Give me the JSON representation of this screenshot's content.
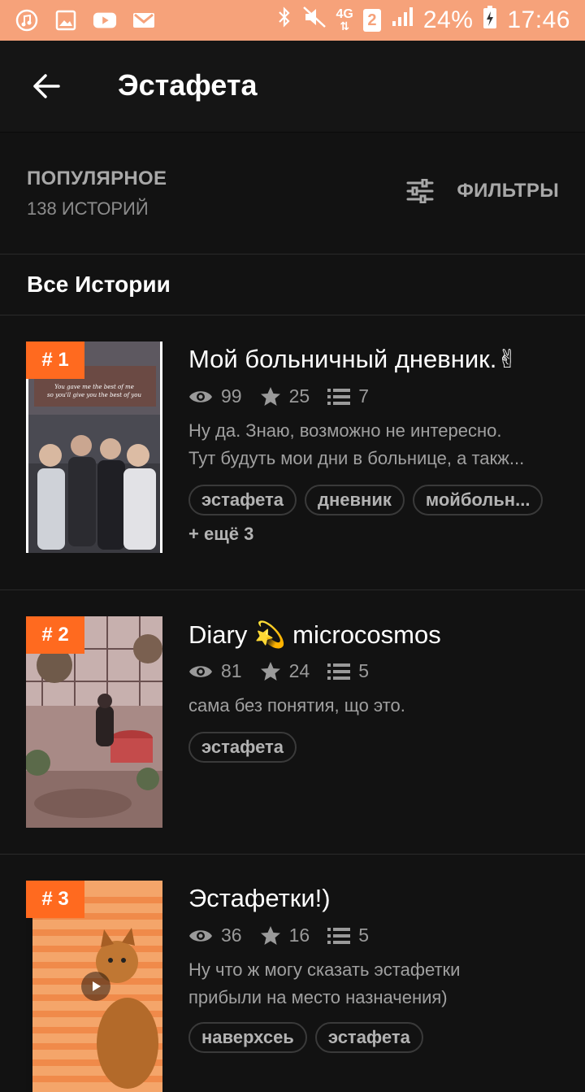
{
  "status_bar": {
    "battery": "24%",
    "time": "17:46",
    "network": "4G",
    "sim": "2",
    "bg_color": "#f6a27a"
  },
  "app_bar": {
    "title": "Эстафета"
  },
  "sort": {
    "label": "ПОПУЛЯРНОЕ",
    "count": "138 ИСТОРИЙ",
    "filter_label": "ФИЛЬТРЫ"
  },
  "section": {
    "title": "Все Истории"
  },
  "accent_color": "#ff6a1f",
  "stories": [
    {
      "rank": "# 1",
      "title": "Мой больничный дневник.✌",
      "views": "99",
      "votes": "25",
      "parts": "7",
      "desc_lines": [
        "Ну да. Знаю, возможно не интересно.",
        "Тут будуть мои дни в больнице, а такж..."
      ],
      "tags": [
        "эстафета",
        "дневник",
        "мойбольн..."
      ],
      "more": "+ ещё 3"
    },
    {
      "rank": "# 2",
      "title": "Diary 💫 microcosmos",
      "views": "81",
      "votes": "24",
      "parts": "5",
      "desc_lines": [
        "сама без понятия, що это."
      ],
      "tags": [
        "эстафета"
      ],
      "more": ""
    },
    {
      "rank": "# 3",
      "title": "Эстафетки!)",
      "views": "36",
      "votes": "16",
      "parts": "5",
      "desc_lines": [
        "Ну что ж могу сказать эстафетки",
        "прибыли на место назначения)"
      ],
      "tags": [
        "наверхсеь",
        "эстафета"
      ],
      "more": ""
    }
  ]
}
